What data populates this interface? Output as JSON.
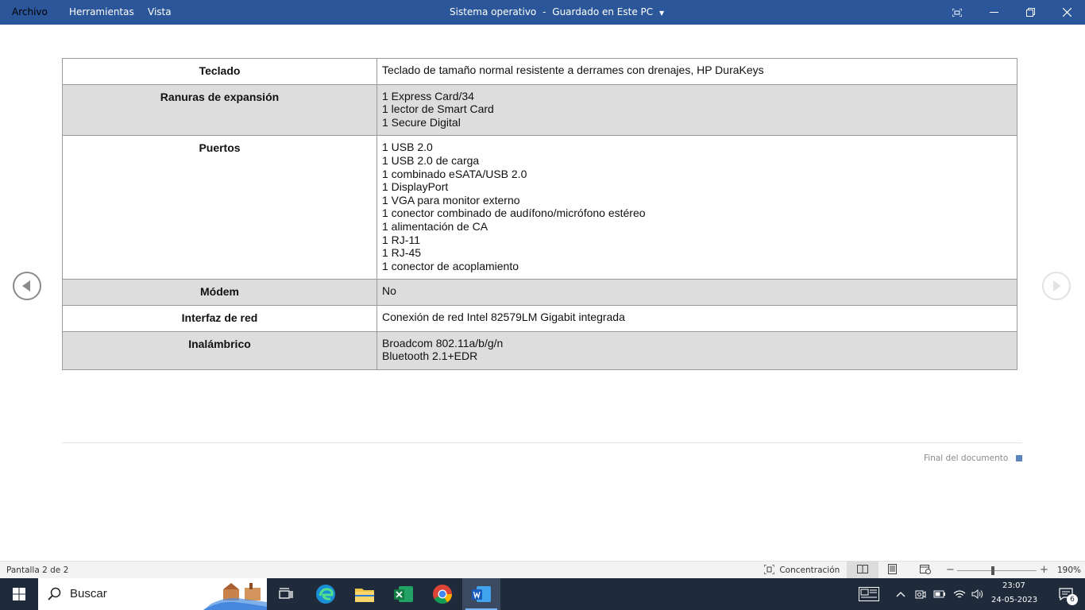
{
  "titlebar": {
    "menu": [
      "Archivo",
      "Herramientas",
      "Vista"
    ],
    "doc_title": "Sistema operativo",
    "separator": "-",
    "save_status": "Guardado en Este PC",
    "color": "#2b579a"
  },
  "table": {
    "rows": [
      {
        "label": "Teclado",
        "values": [
          "Teclado de tamaño normal resistente a derrames con drenajes, HP DuraKeys"
        ]
      },
      {
        "label": "Ranuras de expansión",
        "values": [
          "1 Express Card/34",
          "1 lector de Smart Card",
          "1 Secure Digital"
        ]
      },
      {
        "label": "Puertos",
        "values": [
          "1 USB 2.0",
          "1 USB 2.0 de carga",
          "1 combinado eSATA/USB 2.0",
          "1 DisplayPort",
          "1 VGA para monitor externo",
          "1 conector combinado de audífono/micrófono estéreo",
          "1 alimentación de CA",
          "1 RJ-11",
          "1 RJ-45",
          "1 conector de acoplamiento"
        ]
      },
      {
        "label": "Módem",
        "values": [
          "No"
        ]
      },
      {
        "label": "Interfaz de red",
        "values": [
          "Conexión de red Intel 82579LM Gigabit integrada"
        ]
      },
      {
        "label": "Inalámbrico",
        "values": [
          "Broadcom 802.11a/b/g/n",
          "Bluetooth 2.1+EDR"
        ]
      }
    ]
  },
  "document": {
    "end_label": "Final del documento"
  },
  "statusbar": {
    "page_info": "Pantalla 2 de 2",
    "focus_label": "Concentración",
    "zoom": "190%"
  },
  "taskbar": {
    "search_placeholder": "Buscar",
    "time": "23:07",
    "date": "24-05-2023",
    "notification_count": "6"
  }
}
